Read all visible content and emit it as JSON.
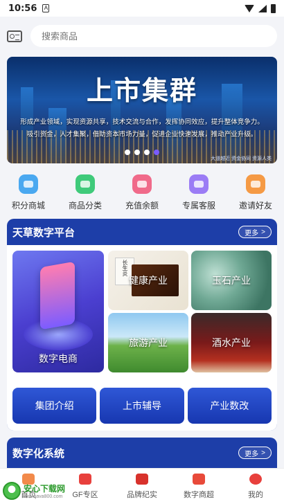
{
  "status_bar": {
    "time": "10:56",
    "sim_letter": "A"
  },
  "search": {
    "placeholder": "搜索商品"
  },
  "banner": {
    "title": "上市集群",
    "line1": "形成产业领域，实现资源共享，技术交流与合作，发挥协同效应，提升整体竞争力。",
    "line2": "吸引资金，人才集聚，借助资本市场力量，促进企业快速发展，推动产业升级。",
    "corner_text": "大道越近 资金协同 资源人类",
    "dots": 4,
    "active_dot": 3
  },
  "quick_menu": [
    {
      "label": "积分商城",
      "icon": "points-mall-icon",
      "color": "#4aa8f0"
    },
    {
      "label": "商品分类",
      "icon": "cart-category-icon",
      "color": "#3fca7a"
    },
    {
      "label": "充值余额",
      "icon": "wallet-icon",
      "color": "#f06a8a"
    },
    {
      "label": "专属客服",
      "icon": "chat-service-icon",
      "color": "#9b7cf5"
    },
    {
      "label": "邀请好友",
      "icon": "invite-icon",
      "color": "#f59a45"
    }
  ],
  "platform": {
    "title": "天草数字平台",
    "more": "更多",
    "tiles": {
      "ecommerce": "数字电商",
      "health": "健康产业",
      "jade": "玉石产业",
      "tourism": "旅游产业",
      "wine": "酒水产业"
    },
    "health_box_text": "长生炎",
    "buttons": [
      "集团介绍",
      "上市辅导",
      "产业数改"
    ]
  },
  "digital_system": {
    "title": "数字化系统",
    "more": "更多"
  },
  "tabbar": [
    {
      "label": "首页",
      "icon": "home-icon"
    },
    {
      "label": "GF专区",
      "icon": "gf-zone-icon"
    },
    {
      "label": "品牌纪实",
      "icon": "brand-record-icon"
    },
    {
      "label": "数字商超",
      "icon": "digital-mall-icon"
    },
    {
      "label": "我的",
      "icon": "profile-icon"
    }
  ],
  "watermark": {
    "title": "安心下载网",
    "url": "www.java800.com",
    "badge": "安心下载"
  },
  "colors": {
    "primary": "#1d3ea8",
    "button": "#2348c4",
    "background": "#f3f4f8"
  }
}
